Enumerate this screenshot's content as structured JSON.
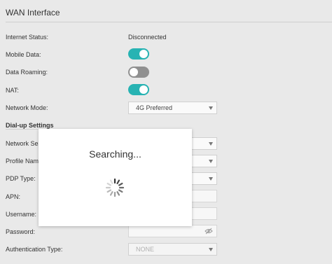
{
  "section": {
    "title": "WAN Interface"
  },
  "fields": {
    "internet_status": {
      "label": "Internet Status:",
      "value": "Disconnected"
    },
    "mobile_data": {
      "label": "Mobile Data:",
      "state": "on"
    },
    "data_roaming": {
      "label": "Data Roaming:",
      "state": "off"
    },
    "nat": {
      "label": "NAT:",
      "state": "on"
    },
    "network_mode": {
      "label": "Network Mode:",
      "value": "4G Preferred"
    }
  },
  "dialup": {
    "heading": "Dial-up Settings",
    "network_search_label": "Network Sea",
    "profile_name_label": "Profile Nam",
    "pdp_type_label": "PDP Type:",
    "apn_label": "APN:",
    "username_label": "Username:",
    "password_label": "Password:",
    "auth_type_label": "Authentication Type:",
    "auth_type_value": "NONE"
  },
  "modal": {
    "text": "Searching..."
  },
  "colors": {
    "toggle_on": "#27b3b3",
    "toggle_off": "#909090",
    "background": "#e9e9e9"
  },
  "icons": {
    "password_visibility": "eye-slash-icon",
    "loading": "spinner-icon"
  }
}
